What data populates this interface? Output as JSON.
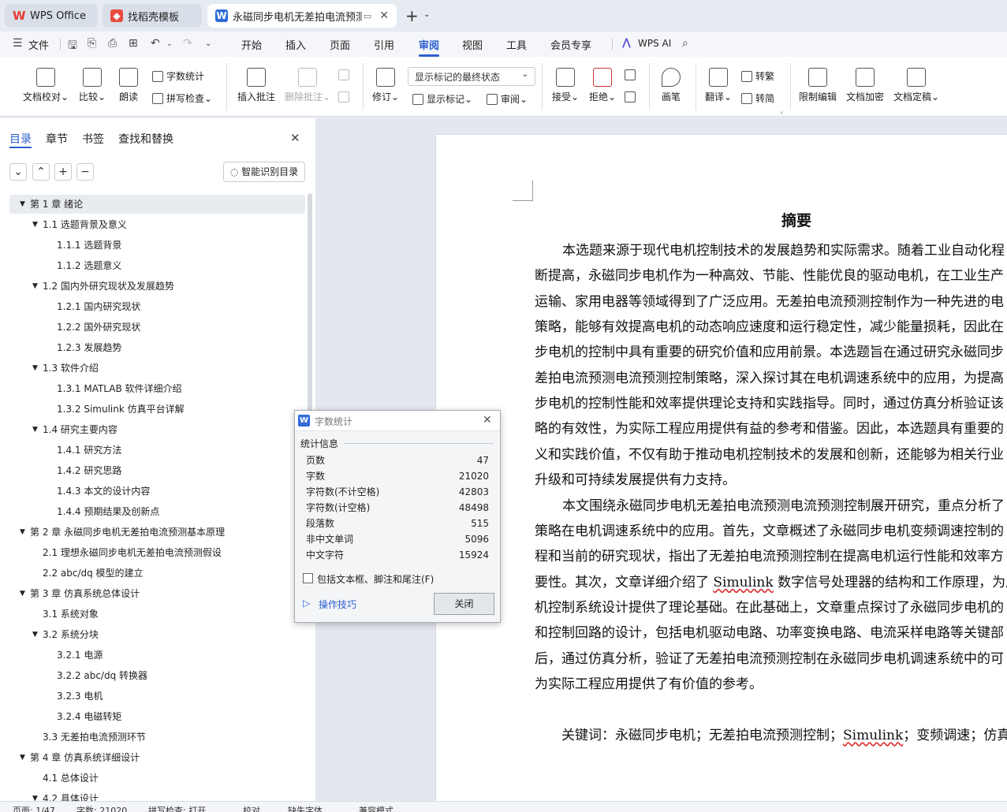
{
  "tabs": [
    {
      "label": "WPS Office"
    },
    {
      "label": "找稻壳模板"
    },
    {
      "label": "永磁同步电机无差拍电流预测"
    }
  ],
  "menu": {
    "file": "文件",
    "items": [
      "开始",
      "插入",
      "页面",
      "引用",
      "审阅",
      "视图",
      "工具",
      "会员专享"
    ],
    "active": "审阅",
    "ai": "WPS AI"
  },
  "ribbon": {
    "proofread": "文档校对",
    "compare": "比较",
    "read_aloud": "朗读",
    "word_count": "字数统计",
    "spell_check": "拼写检查",
    "insert_comment": "插入批注",
    "delete_comment": "删除批注",
    "track_changes": "修订",
    "markup_state": "显示标记的最终状态",
    "show_markup": "显示标记",
    "review": "审阅",
    "accept": "接受",
    "reject": "拒绝",
    "pen": "画笔",
    "translate": "翻译",
    "to_traditional": "转繁",
    "to_simplified": "转简",
    "restrict_edit": "限制编辑",
    "encrypt": "文档加密",
    "finalize": "文档定稿"
  },
  "nav": {
    "tabs": [
      "目录",
      "章节",
      "书签",
      "查找和替换"
    ],
    "smart_toc": "智能识别目录",
    "toc": [
      {
        "text": "第 1 章  绪论",
        "level": 0,
        "arrow": true
      },
      {
        "text": "1.1  选题背景及意义",
        "level": 1,
        "arrow": true
      },
      {
        "text": "1.1.1  选题背景",
        "level": 2,
        "arrow": false
      },
      {
        "text": "1.1.2  选题意义",
        "level": 2,
        "arrow": false
      },
      {
        "text": "1.2  国内外研究现状及发展趋势",
        "level": 1,
        "arrow": true
      },
      {
        "text": "1.2.1  国内研究现状",
        "level": 2,
        "arrow": false
      },
      {
        "text": "1.2.2  国外研究现状",
        "level": 2,
        "arrow": false
      },
      {
        "text": "1.2.3  发展趋势",
        "level": 2,
        "arrow": false
      },
      {
        "text": "1.3  软件介绍",
        "level": 1,
        "arrow": true
      },
      {
        "text": "1.3.1 MATLAB 软件详细介绍",
        "level": 2,
        "arrow": false
      },
      {
        "text": "1.3.2 Simulink 仿真平台详解",
        "level": 2,
        "arrow": false
      },
      {
        "text": "1.4 研究主要内容",
        "level": 1,
        "arrow": true
      },
      {
        "text": "1.4.1  研究方法",
        "level": 2,
        "arrow": false
      },
      {
        "text": "1.4.2  研究思路",
        "level": 2,
        "arrow": false
      },
      {
        "text": "1.4.3  本文的设计内容",
        "level": 2,
        "arrow": false
      },
      {
        "text": "1.4.4  预期结果及创新点",
        "level": 2,
        "arrow": false
      },
      {
        "text": "第 2 章  永磁同步电机无差拍电流预测基本原理",
        "level": 0,
        "arrow": true
      },
      {
        "text": "2.1 理想永磁同步电机无差拍电流预测假设",
        "level": 1,
        "arrow": false
      },
      {
        "text": "2.2 abc/dq 模型的建立",
        "level": 1,
        "arrow": false
      },
      {
        "text": "第 3 章  仿真系统总体设计",
        "level": 0,
        "arrow": true
      },
      {
        "text": "3.1 系统对象",
        "level": 1,
        "arrow": false
      },
      {
        "text": "3.2 系统分块",
        "level": 1,
        "arrow": true
      },
      {
        "text": "3.2.1 电源",
        "level": 2,
        "arrow": false
      },
      {
        "text": "3.2.2 abc/dq 转换器",
        "level": 2,
        "arrow": false
      },
      {
        "text": "3.2.3 电机",
        "level": 2,
        "arrow": false
      },
      {
        "text": "3.2.4 电磁转矩",
        "level": 2,
        "arrow": false
      },
      {
        "text": "3.3 无差拍电流预测环节",
        "level": 1,
        "arrow": false
      },
      {
        "text": "第 4 章  仿真系统详细设计",
        "level": 0,
        "arrow": true
      },
      {
        "text": "4.1 总体设计",
        "level": 1,
        "arrow": false
      },
      {
        "text": "4.2 具体设计",
        "level": 1,
        "arrow": true
      }
    ]
  },
  "doc": {
    "heading": "摘要",
    "lines": [
      "本选题来源于现代电机控制技术的发展趋势和实际需求。随着工业自动化程",
      "断提高，永磁同步电机作为一种高效、节能、性能优良的驱动电机，在工业生产",
      "运输、家用电器等领域得到了广泛应用。无差拍电流预测控制作为一种先进的电",
      "策略，能够有效提高电机的动态响应速度和运行稳定性，减少能量损耗，因此在",
      "步电机的控制中具有重要的研究价值和应用前景。本选题旨在通过研究永磁同步",
      "差拍电流预测电流预测控制策略，深入探讨其在电机调速系统中的应用，为提高",
      "步电机的控制性能和效率提供理论支持和实践指导。同时，通过仿真分析验证该",
      "略的有效性，为实际工程应用提供有益的参考和借鉴。因此，本选题具有重要的",
      "义和实践价值，不仅有助于推动电机控制技术的发展和创新，还能够为相关行业",
      "升级和可持续发展提供有力支持。",
      "本文围绕永磁同步电机无差拍电流预测电流预测控制展开研究，重点分析了",
      "策略在电机调速系统中的应用。首先，文章概述了永磁同步电机变频调速控制的",
      "程和当前的研究现状，指出了无差拍电流预测控制在提高电机运行性能和效率方",
      "要性。其次，文章详细介绍了 Simulink 数字信号处理器的结构和工作原理，为后",
      "机控制系统设计提供了理论基础。在此基础上，文章重点探讨了永磁同步电机的",
      "和控制回路的设计，包括电机驱动电路、功率变换电路、电流采样电路等关键部",
      "后，通过仿真分析，验证了无差拍电流预测控制在永磁同步电机调速系统中的可",
      "为实际工程应用提供了有价值的参考。"
    ],
    "keywords": "关键词：永磁同步电机；无差拍电流预测控制；Simulink；变频调速；仿真"
  },
  "dialog": {
    "title": "字数统计",
    "section": "统计信息",
    "rows": [
      {
        "label": "页数",
        "value": "47"
      },
      {
        "label": "字数",
        "value": "21020"
      },
      {
        "label": "字符数(不计空格)",
        "value": "42803"
      },
      {
        "label": "字符数(计空格)",
        "value": "48498"
      },
      {
        "label": "段落数",
        "value": "515"
      },
      {
        "label": "非中文单词",
        "value": "5096"
      },
      {
        "label": "中文字符",
        "value": "15924"
      }
    ],
    "include_label": "包括文本框、脚注和尾注(F)",
    "tips": "操作技巧",
    "close": "关闭"
  },
  "status": {
    "page": "页面: 1/47",
    "words": "字数: 21020",
    "spell": "拼写检查: 打开",
    "proof": "校对",
    "font": "缺失字体",
    "compat": "兼容模式"
  },
  "colors": {
    "accent": "#2b5fce",
    "wps_red": "#e8382f",
    "docer_red": "#e94b3c",
    "writer_blue": "#2f6bd8"
  }
}
